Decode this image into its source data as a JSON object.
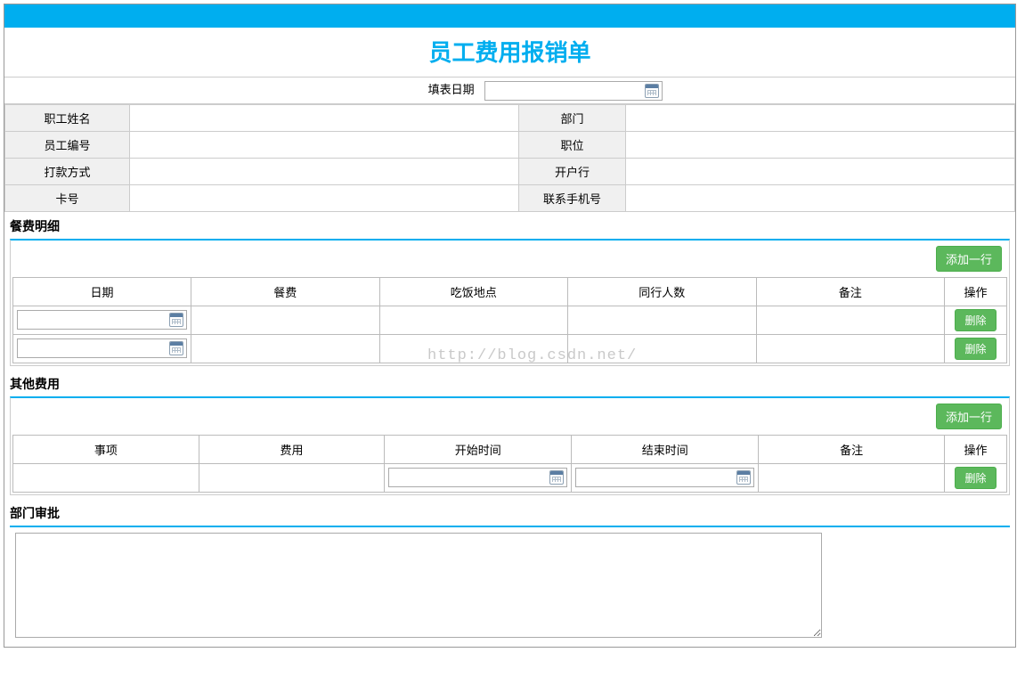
{
  "title": "员工费用报销单",
  "filldate": {
    "label": "填表日期",
    "value": ""
  },
  "info": {
    "rows": [
      {
        "l1": "职工姓名",
        "v1": "",
        "l2": "部门",
        "v2": ""
      },
      {
        "l1": "员工编号",
        "v1": "",
        "l2": "职位",
        "v2": ""
      },
      {
        "l1": "打款方式",
        "v1": "",
        "l2": "开户行",
        "v2": ""
      },
      {
        "l1": "卡号",
        "v1": "",
        "l2": "联系手机号",
        "v2": ""
      }
    ]
  },
  "meal": {
    "section_title": "餐费明细",
    "add_label": "添加一行",
    "headers": [
      "日期",
      "餐费",
      "吃饭地点",
      "同行人数",
      "备注",
      "操作"
    ],
    "rows": [
      {
        "date": "",
        "fee": "",
        "place": "",
        "people": "",
        "remark": "",
        "op": "删除"
      },
      {
        "date": "",
        "fee": "",
        "place": "",
        "people": "",
        "remark": "",
        "op": "删除"
      }
    ]
  },
  "other": {
    "section_title": "其他费用",
    "add_label": "添加一行",
    "headers": [
      "事项",
      "费用",
      "开始时间",
      "结束时间",
      "备注",
      "操作"
    ],
    "rows": [
      {
        "item": "",
        "fee": "",
        "start": "",
        "end": "",
        "remark": "",
        "op": "删除"
      }
    ]
  },
  "approve": {
    "section_title": "部门审批",
    "value": ""
  },
  "watermark": "http://blog.csdn.net/"
}
